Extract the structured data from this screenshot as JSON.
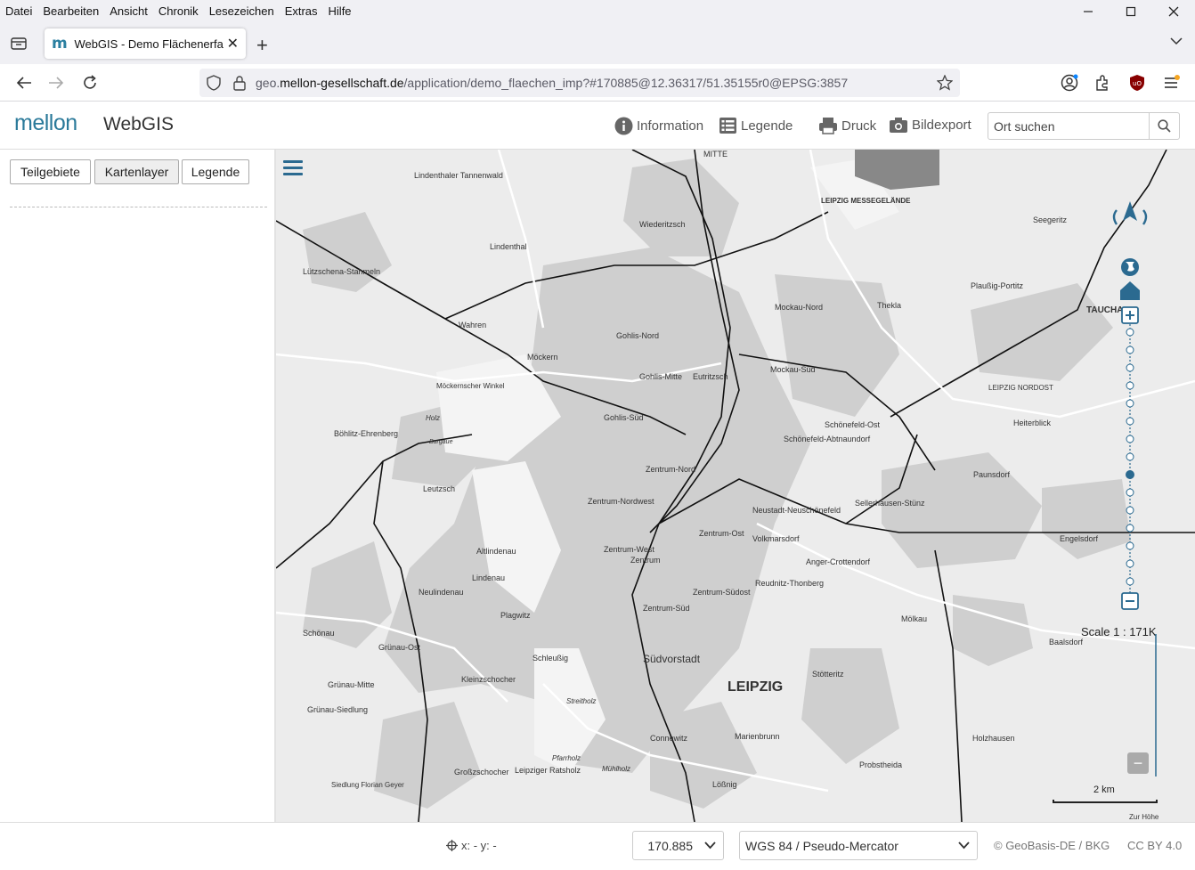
{
  "menu": [
    "Datei",
    "Bearbeiten",
    "Ansicht",
    "Chronik",
    "Lesezeichen",
    "Extras",
    "Hilfe"
  ],
  "tab": {
    "favicon": "m",
    "title": "WebGIS - Demo Flächenerfassung"
  },
  "url": {
    "prefix": "geo.",
    "domain": "mellon-gesellschaft.de",
    "path": "/application/demo_flaechen_imp?#170885@12.36317/51.35155r0@EPSG:3857"
  },
  "header": {
    "logo": "mellon",
    "title": "WebGIS",
    "buttons": {
      "information": "Information",
      "legend": "Legende",
      "print": "Druck",
      "export": "Bildexport"
    },
    "search_placeholder": "Ort suchen"
  },
  "sidebar": {
    "tabs": [
      "Teilgebiete",
      "Kartenlayer",
      "Legende"
    ],
    "active_tab": "Kartenlayer"
  },
  "map": {
    "scale_label": "Scale 1 : 171K",
    "scalebar_label": "2 km",
    "labels": [
      "MITTE",
      "Lindenthaler Tannenwald",
      "LEIPZIG MESSEGELÄNDE",
      "Seegeritz",
      "Wiederitzsch",
      "Lindenthal",
      "Lützschena-Stahmeln",
      "Wahren",
      "Plaußig-Portitz",
      "TAUCHA",
      "Thekla",
      "Mockau-Nord",
      "Gohlis-Nord",
      "Möckern",
      "Mockau-Süd",
      "Gohlis-Mitte",
      "Eutritzsch",
      "LEIPZIG NORDOST",
      "Möckernscher Winkel",
      "Heiterblick",
      "Gohlis-Süd",
      "Schönefeld-Ost",
      "Böhlitz-Ehrenberg",
      "Schönefeld-Abtnaundorf",
      "Zentrum-Nord",
      "Leutzsch",
      "Paunsdorf",
      "Zentrum-Nordwest",
      "Sellerhausen-Stünz",
      "Neustadt-Neuschönefeld",
      "Engelsdorf",
      "Zentrum-Ost",
      "Volkmarsdorf",
      "Altlindenau",
      "Zentrum-West",
      "Zentrum",
      "Lindenau",
      "Anger-Crottendorf",
      "Neulindenau",
      "Reudnitz-Thonberg",
      "Zentrum-Südost",
      "Zentrum-Süd",
      "Plagwitz",
      "Mölkau",
      "Schönau",
      "Grünau-Ost",
      "Baalsdorf",
      "Schleußig",
      "Südvorstadt",
      "LEIPZIG",
      "Grünau-Mitte",
      "Kleinzschocher",
      "Stötteritz",
      "Grünau-Siedlung",
      "Connewitz",
      "Marienbrunn",
      "Holzhausen",
      "Probstheida",
      "Großzschocher",
      "Leipziger Ratsholz",
      "Lößnig",
      "Siedlung Florian Geyer",
      "Zur Höhe",
      "Holz",
      "Burgaue",
      "Streitholz",
      "Pfarrholz",
      "Mühlholz"
    ]
  },
  "footer": {
    "coords": "x: - y: -",
    "scale_select": "170.885",
    "projection_select": "WGS 84 / Pseudo-Mercator",
    "attribution": "© GeoBasis-DE / BKG",
    "license": "CC BY 4.0"
  },
  "colors": {
    "brand": "#2b7a9a",
    "nav_blue": "#2b6a90",
    "map_bg": "#ececec"
  }
}
